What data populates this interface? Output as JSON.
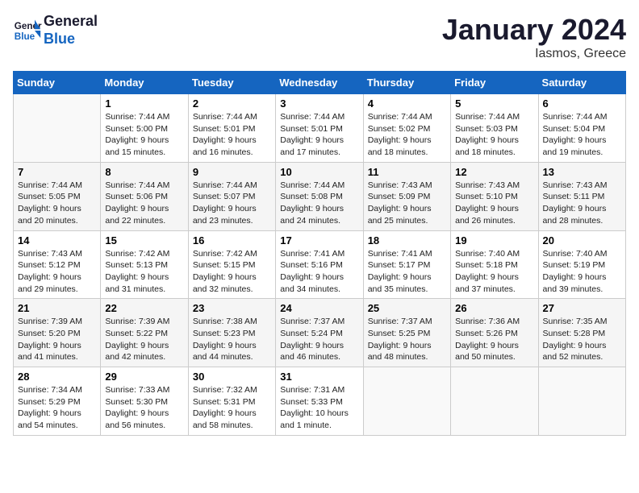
{
  "header": {
    "logo_line1": "General",
    "logo_line2": "Blue",
    "month_title": "January 2024",
    "location": "Iasmos, Greece"
  },
  "weekdays": [
    "Sunday",
    "Monday",
    "Tuesday",
    "Wednesday",
    "Thursday",
    "Friday",
    "Saturday"
  ],
  "weeks": [
    [
      {
        "day": "",
        "sunrise": "",
        "sunset": "",
        "daylight": ""
      },
      {
        "day": "1",
        "sunrise": "Sunrise: 7:44 AM",
        "sunset": "Sunset: 5:00 PM",
        "daylight": "Daylight: 9 hours and 15 minutes."
      },
      {
        "day": "2",
        "sunrise": "Sunrise: 7:44 AM",
        "sunset": "Sunset: 5:01 PM",
        "daylight": "Daylight: 9 hours and 16 minutes."
      },
      {
        "day": "3",
        "sunrise": "Sunrise: 7:44 AM",
        "sunset": "Sunset: 5:01 PM",
        "daylight": "Daylight: 9 hours and 17 minutes."
      },
      {
        "day": "4",
        "sunrise": "Sunrise: 7:44 AM",
        "sunset": "Sunset: 5:02 PM",
        "daylight": "Daylight: 9 hours and 18 minutes."
      },
      {
        "day": "5",
        "sunrise": "Sunrise: 7:44 AM",
        "sunset": "Sunset: 5:03 PM",
        "daylight": "Daylight: 9 hours and 18 minutes."
      },
      {
        "day": "6",
        "sunrise": "Sunrise: 7:44 AM",
        "sunset": "Sunset: 5:04 PM",
        "daylight": "Daylight: 9 hours and 19 minutes."
      }
    ],
    [
      {
        "day": "7",
        "sunrise": "Sunrise: 7:44 AM",
        "sunset": "Sunset: 5:05 PM",
        "daylight": "Daylight: 9 hours and 20 minutes."
      },
      {
        "day": "8",
        "sunrise": "Sunrise: 7:44 AM",
        "sunset": "Sunset: 5:06 PM",
        "daylight": "Daylight: 9 hours and 22 minutes."
      },
      {
        "day": "9",
        "sunrise": "Sunrise: 7:44 AM",
        "sunset": "Sunset: 5:07 PM",
        "daylight": "Daylight: 9 hours and 23 minutes."
      },
      {
        "day": "10",
        "sunrise": "Sunrise: 7:44 AM",
        "sunset": "Sunset: 5:08 PM",
        "daylight": "Daylight: 9 hours and 24 minutes."
      },
      {
        "day": "11",
        "sunrise": "Sunrise: 7:43 AM",
        "sunset": "Sunset: 5:09 PM",
        "daylight": "Daylight: 9 hours and 25 minutes."
      },
      {
        "day": "12",
        "sunrise": "Sunrise: 7:43 AM",
        "sunset": "Sunset: 5:10 PM",
        "daylight": "Daylight: 9 hours and 26 minutes."
      },
      {
        "day": "13",
        "sunrise": "Sunrise: 7:43 AM",
        "sunset": "Sunset: 5:11 PM",
        "daylight": "Daylight: 9 hours and 28 minutes."
      }
    ],
    [
      {
        "day": "14",
        "sunrise": "Sunrise: 7:43 AM",
        "sunset": "Sunset: 5:12 PM",
        "daylight": "Daylight: 9 hours and 29 minutes."
      },
      {
        "day": "15",
        "sunrise": "Sunrise: 7:42 AM",
        "sunset": "Sunset: 5:13 PM",
        "daylight": "Daylight: 9 hours and 31 minutes."
      },
      {
        "day": "16",
        "sunrise": "Sunrise: 7:42 AM",
        "sunset": "Sunset: 5:15 PM",
        "daylight": "Daylight: 9 hours and 32 minutes."
      },
      {
        "day": "17",
        "sunrise": "Sunrise: 7:41 AM",
        "sunset": "Sunset: 5:16 PM",
        "daylight": "Daylight: 9 hours and 34 minutes."
      },
      {
        "day": "18",
        "sunrise": "Sunrise: 7:41 AM",
        "sunset": "Sunset: 5:17 PM",
        "daylight": "Daylight: 9 hours and 35 minutes."
      },
      {
        "day": "19",
        "sunrise": "Sunrise: 7:40 AM",
        "sunset": "Sunset: 5:18 PM",
        "daylight": "Daylight: 9 hours and 37 minutes."
      },
      {
        "day": "20",
        "sunrise": "Sunrise: 7:40 AM",
        "sunset": "Sunset: 5:19 PM",
        "daylight": "Daylight: 9 hours and 39 minutes."
      }
    ],
    [
      {
        "day": "21",
        "sunrise": "Sunrise: 7:39 AM",
        "sunset": "Sunset: 5:20 PM",
        "daylight": "Daylight: 9 hours and 41 minutes."
      },
      {
        "day": "22",
        "sunrise": "Sunrise: 7:39 AM",
        "sunset": "Sunset: 5:22 PM",
        "daylight": "Daylight: 9 hours and 42 minutes."
      },
      {
        "day": "23",
        "sunrise": "Sunrise: 7:38 AM",
        "sunset": "Sunset: 5:23 PM",
        "daylight": "Daylight: 9 hours and 44 minutes."
      },
      {
        "day": "24",
        "sunrise": "Sunrise: 7:37 AM",
        "sunset": "Sunset: 5:24 PM",
        "daylight": "Daylight: 9 hours and 46 minutes."
      },
      {
        "day": "25",
        "sunrise": "Sunrise: 7:37 AM",
        "sunset": "Sunset: 5:25 PM",
        "daylight": "Daylight: 9 hours and 48 minutes."
      },
      {
        "day": "26",
        "sunrise": "Sunrise: 7:36 AM",
        "sunset": "Sunset: 5:26 PM",
        "daylight": "Daylight: 9 hours and 50 minutes."
      },
      {
        "day": "27",
        "sunrise": "Sunrise: 7:35 AM",
        "sunset": "Sunset: 5:28 PM",
        "daylight": "Daylight: 9 hours and 52 minutes."
      }
    ],
    [
      {
        "day": "28",
        "sunrise": "Sunrise: 7:34 AM",
        "sunset": "Sunset: 5:29 PM",
        "daylight": "Daylight: 9 hours and 54 minutes."
      },
      {
        "day": "29",
        "sunrise": "Sunrise: 7:33 AM",
        "sunset": "Sunset: 5:30 PM",
        "daylight": "Daylight: 9 hours and 56 minutes."
      },
      {
        "day": "30",
        "sunrise": "Sunrise: 7:32 AM",
        "sunset": "Sunset: 5:31 PM",
        "daylight": "Daylight: 9 hours and 58 minutes."
      },
      {
        "day": "31",
        "sunrise": "Sunrise: 7:31 AM",
        "sunset": "Sunset: 5:33 PM",
        "daylight": "Daylight: 10 hours and 1 minute."
      },
      {
        "day": "",
        "sunrise": "",
        "sunset": "",
        "daylight": ""
      },
      {
        "day": "",
        "sunrise": "",
        "sunset": "",
        "daylight": ""
      },
      {
        "day": "",
        "sunrise": "",
        "sunset": "",
        "daylight": ""
      }
    ]
  ]
}
